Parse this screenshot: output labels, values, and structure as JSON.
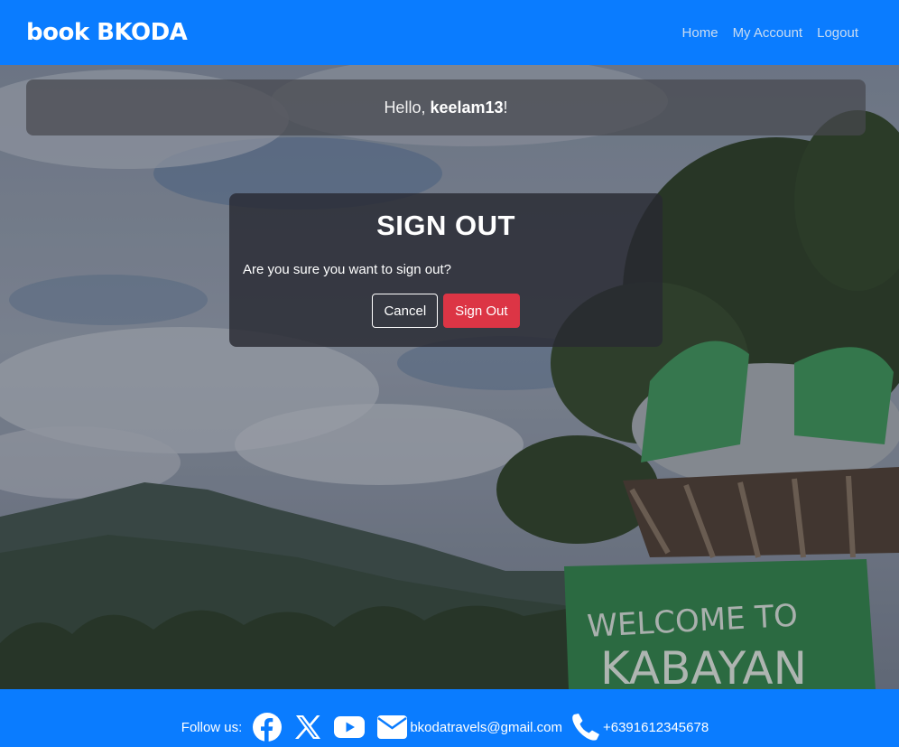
{
  "navbar": {
    "brand": "book BKODA",
    "links": [
      "Home",
      "My Account",
      "Logout"
    ]
  },
  "greeting": {
    "prefix": "Hello, ",
    "username": "keelam13",
    "suffix": "!"
  },
  "signout": {
    "title": "SIGN OUT",
    "message": "Are you sure you want to sign out?",
    "cancel_label": "Cancel",
    "confirm_label": "Sign Out"
  },
  "footer": {
    "follow_label": "Follow us:",
    "email": "bkodatravels@gmail.com",
    "phone": "+6391612345678",
    "icons": [
      "facebook-icon",
      "x-icon",
      "youtube-icon",
      "envelope-icon",
      "phone-icon"
    ]
  },
  "background": {
    "sign_text_top": "WELCOME TO",
    "sign_text_bottom": "KABAYAN"
  },
  "colors": {
    "brand_blue": "#0a7cff",
    "danger_red": "#dc3545"
  }
}
